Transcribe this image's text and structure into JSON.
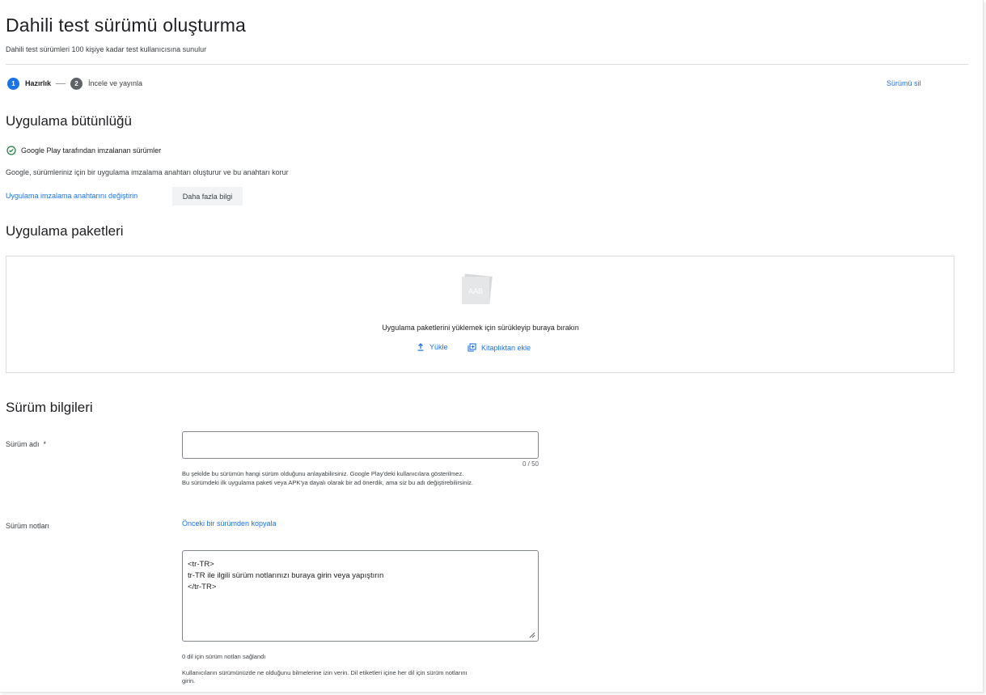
{
  "page": {
    "title": "Dahili test sürümü oluşturma",
    "subtitle": "Dahili test sürümleri 100 kişiye kadar test kullanıcısına sunulur"
  },
  "steps": [
    {
      "number": "1",
      "label": "Hazırlık",
      "state": "active"
    },
    {
      "number": "2",
      "label": "İncele ve yayınla",
      "state": "inactive"
    }
  ],
  "delete_release_label": "Sürümü sil",
  "integrity": {
    "title": "Uygulama bütünlüğü",
    "signed_status": "Google Play tarafından imzalanan sürümler",
    "description": "Google, sürümleriniz için bir uygulama imzalama anahtarı oluşturur ve bu anahtarı korur",
    "change_key_link": "Uygulama imzalama anahtarını değiştirin",
    "more_info_button": "Daha fazla bilgi"
  },
  "bundles": {
    "title": "Uygulama paketleri",
    "icon_text": "AAB",
    "drop_text": "Uygulama paketlerini yüklemek için sürükleyip buraya bırakın",
    "upload_label": "Yükle",
    "library_label": "Kitaplıktan ekle"
  },
  "release_info": {
    "title": "Sürüm bilgileri",
    "name_label": "Sürüm adı",
    "required_mark": "*",
    "name_value": "",
    "counter": "0 / 50",
    "name_help_1": "Bu şekilde bu sürümün hangi sürüm olduğunu anlayabilirsiniz. Google Play'deki kullanıcılara gösterilmez.",
    "name_help_2": "Bu sürümdeki ilk uygulama paketi veya APK'ya dayalı olarak bir ad önerdik, ama siz bu adı değiştirebilirsiniz.",
    "notes_label": "Sürüm notları",
    "copy_link": "Önceki bir sürümden kopyala",
    "notes_lines": [
      "<tr-TR>",
      "tr-TR ile ilgili sürüm notlarınızı buraya girin veya yapıştırın",
      "</tr-TR>"
    ],
    "notes_count": "0 dil için sürüm notları sağlandı",
    "notes_help_1": "Kullanıcıların sürümünüzde ne olduğunu bilmelerine izin verin. Dil etiketleri içine her dil için sürüm notlarını",
    "notes_help_2": "girin."
  },
  "colors": {
    "accent": "#1a73e8",
    "active_step": "#1a73e8",
    "inactive_step": "#5f6368",
    "success": "#188038"
  },
  "icons": [
    "check-circle-icon",
    "upload-icon",
    "library-add-icon",
    "aab-file-icon",
    "resize-handle-icon"
  ]
}
